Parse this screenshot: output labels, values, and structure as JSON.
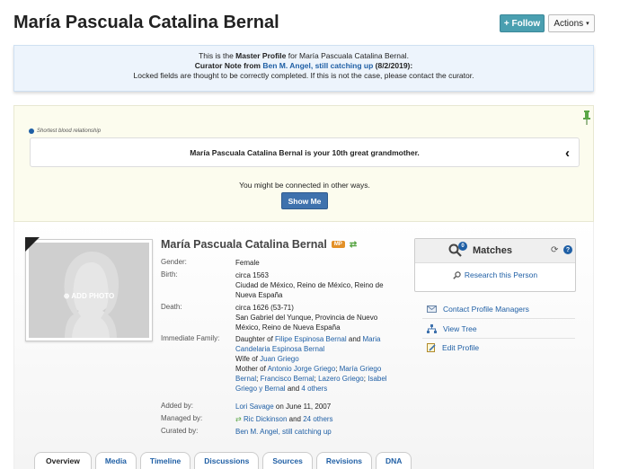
{
  "header": {
    "title": "María Pascuala Catalina Bernal",
    "follow_label": "+ Follow",
    "actions_label": "Actions"
  },
  "master_notice": {
    "line1_prefix": "This is the ",
    "line1_bold": "Master Profile",
    "line1_suffix": " for María Pascuala Catalina Bernal.",
    "curator_prefix": "Curator Note from ",
    "curator_name": "Ben M. Angel, still catching up",
    "curator_date": " (8/2/2019):",
    "line3": "Locked fields are thought to be correctly completed. If this is not the case, please contact the curator."
  },
  "relationship": {
    "heading": "Shortest blood relationship",
    "statement": "María Pascuala Catalina Bernal is your 10th great grandmother.",
    "connected_text": "You might be connected in other ways.",
    "show_me_label": "Show Me"
  },
  "profile": {
    "name": "María Pascuala Catalina Bernal",
    "badge": "MP",
    "add_photo_label": "ADD PHOTO",
    "gender_label": "Gender:",
    "gender": "Female",
    "birth_label": "Birth:",
    "birth_date": "circa 1563",
    "birth_place": "Ciudad de México, Reino de México, Reino de Nueva España",
    "death_label": "Death:",
    "death_date": "circa 1626 (53-71)",
    "death_place": "San Gabriel del Yunque, Provincia de Nuevo México, Reino de Nueva España",
    "family_label": "Immediate Family:",
    "daughter_of_prefix": "Daughter of ",
    "father": "Filipe Espinosa Bernal",
    "and_1": " and ",
    "mother": "Maria Candelaria Espinosa Bernal",
    "wife_of_prefix": "Wife of ",
    "husband": "Juan Griego",
    "mother_of_prefix": "Mother of ",
    "child_1": "Antonio Jorge Griego",
    "sep_1": "; ",
    "child_2": "María Griego Bernal",
    "sep_2": "; ",
    "child_3": "Francisco Bernal",
    "sep_3": "; ",
    "child_4": "Lazero Griego",
    "sep_4": "; ",
    "child_5": "Isabel Griego y Bernal",
    "and_2": " and ",
    "others": "4 others",
    "added_by_label": "Added by:",
    "added_by": "Lori Savage",
    "added_on": " on June 11, 2007",
    "managed_by_label": "Managed by:",
    "managed_by": "Ric Dickinson",
    "managed_and": " and ",
    "managed_others": "24 others",
    "curated_by_label": "Curated by:",
    "curated_by": "Ben M. Angel, still catching up"
  },
  "matches": {
    "count": "0",
    "title": "Matches",
    "research_label": "Research this Person"
  },
  "side_links": {
    "contact": "Contact Profile Managers",
    "view_tree": "View Tree",
    "edit": "Edit Profile"
  },
  "tabs": [
    "Overview",
    "Media",
    "Timeline",
    "Discussions",
    "Sources",
    "Revisions",
    "DNA"
  ],
  "colors": {
    "link": "#1f5fa5",
    "follow": "#4a9fb0",
    "notice_bg": "#edf4fc",
    "relationship_bg": "#fcfcee",
    "mp_badge": "#e39027",
    "pin": "#5aa646"
  }
}
